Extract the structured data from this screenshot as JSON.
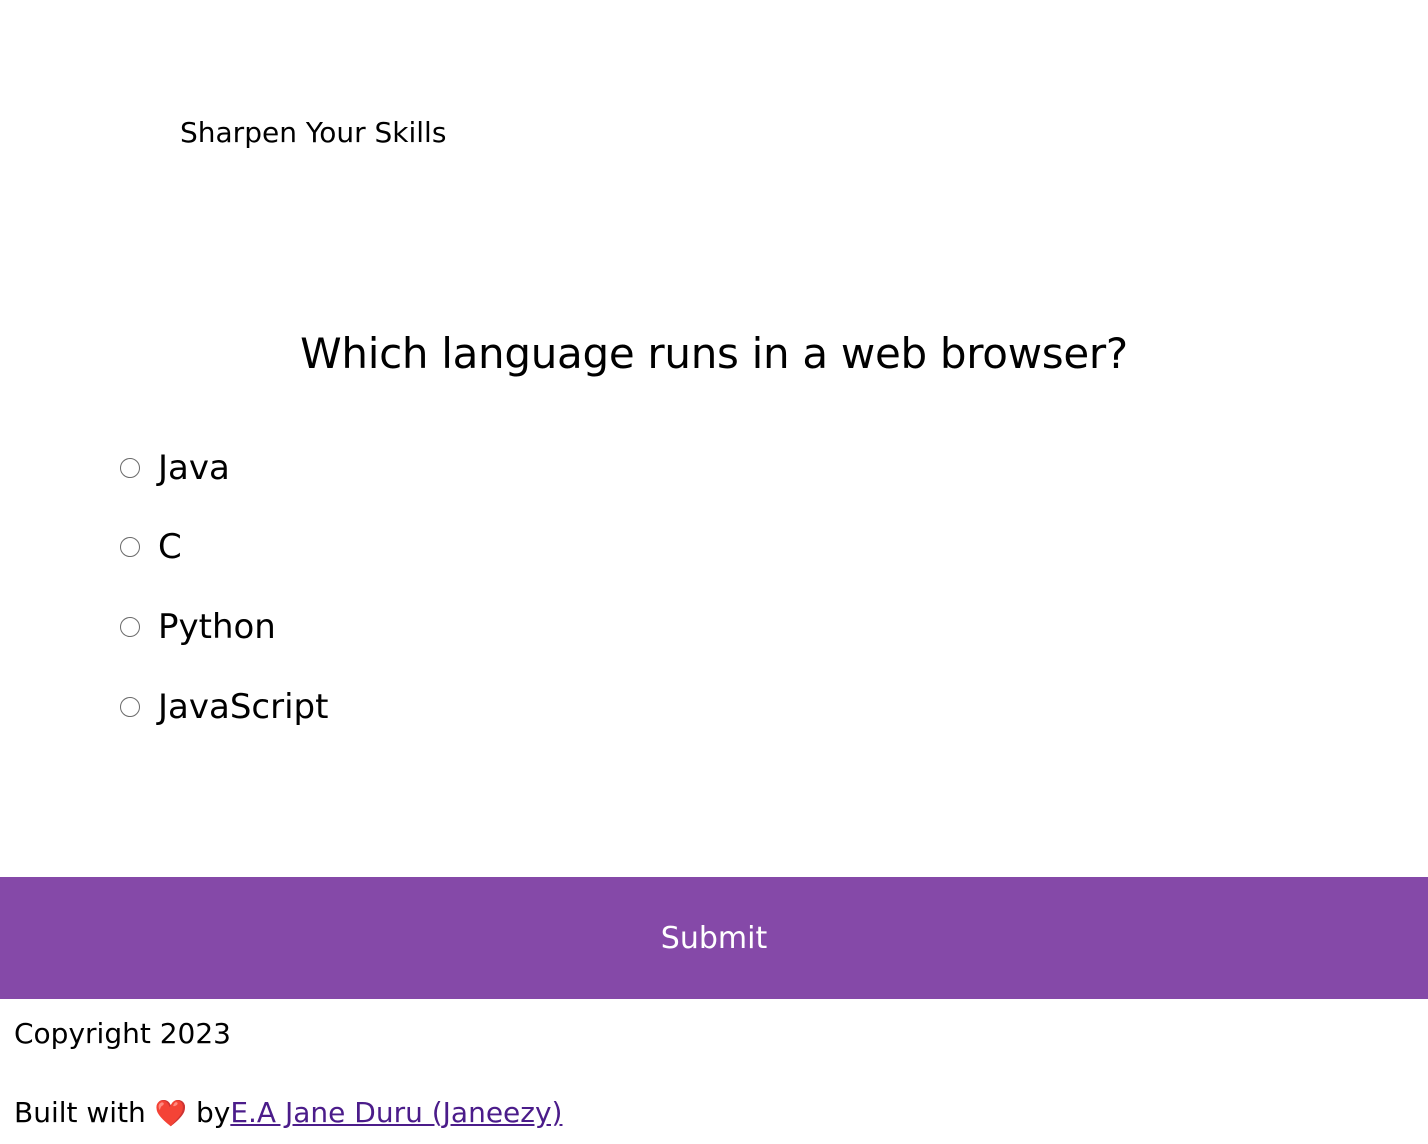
{
  "header": {
    "title": "Sharpen Your Skills"
  },
  "quiz": {
    "question": "Which language runs in a web browser?",
    "answers": [
      {
        "label": "Java"
      },
      {
        "label": "C"
      },
      {
        "label": "Python"
      },
      {
        "label": "JavaScript"
      }
    ],
    "submit_label": "Submit"
  },
  "footer": {
    "copyright": "Copyright 2023",
    "built_with_prefix": "Built with ",
    "heart": "❤️",
    "by": " by",
    "author_link": "E.A Jane Duru (Janeezy)"
  },
  "colors": {
    "accent": "#8549a8",
    "link": "#4b1c8a",
    "heart": "#e0201e"
  },
  "icons": {
    "heart": "heart-icon",
    "radio": "radio-button"
  }
}
